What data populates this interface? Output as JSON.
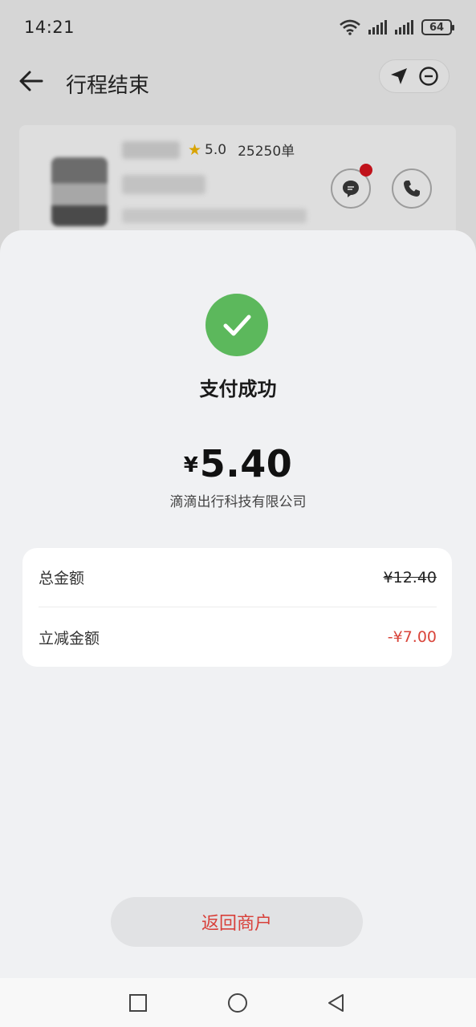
{
  "status_bar": {
    "time": "14:21",
    "battery": "64"
  },
  "nav": {
    "title": "行程结束",
    "back_icon": "arrow-left-icon",
    "actions": [
      "navigate-arrow-icon",
      "minus-circle-icon"
    ]
  },
  "driver": {
    "rating": "5.0",
    "orders": "25250单",
    "message_icon": "chat-bubble-icon",
    "call_icon": "phone-icon"
  },
  "payment": {
    "status": "支付成功",
    "currency": "¥",
    "amount": "5.40",
    "merchant": "滴滴出行科技有限公司"
  },
  "details": {
    "total_label": "总金额",
    "total_value": "¥12.40",
    "discount_label": "立减金额",
    "discount_value": "-¥7.00"
  },
  "actions": {
    "return_label": "返回商户"
  },
  "colors": {
    "success": "#5cb85c",
    "accent_red": "#d9453b"
  }
}
